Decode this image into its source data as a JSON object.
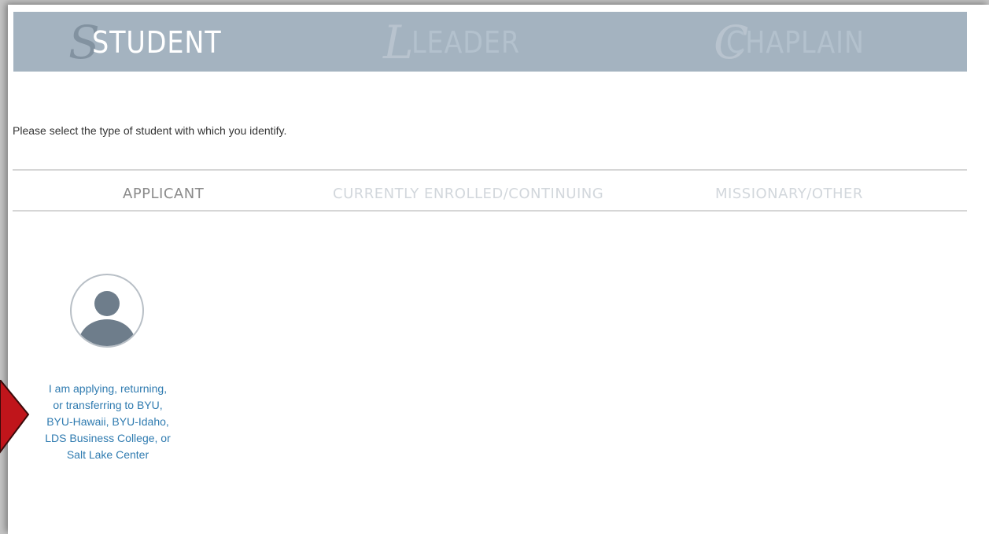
{
  "roles": [
    {
      "initial": "S",
      "label": "STUDENT",
      "active": true
    },
    {
      "initial": "L",
      "label": "LEADER",
      "active": false
    },
    {
      "initial": "C",
      "label": "CHAPLAIN",
      "active": false
    }
  ],
  "prompt": "Please select the type of student with which you identify.",
  "student_types": [
    {
      "label": "APPLICANT",
      "active": true
    },
    {
      "label": "CURRENTLY ENROLLED/CONTINUING",
      "active": false
    },
    {
      "label": "MISSIONARY/OTHER",
      "active": false
    }
  ],
  "applicant_card": {
    "icon": "user-avatar-icon",
    "text": "I am applying, returning,\nor transferring to BYU,\nBYU-Hawaii, BYU-Idaho,\nLDS Business College, or\nSalt Lake Center"
  },
  "colors": {
    "role_bar": "#a4b3c0",
    "active_role": "#ffffff",
    "link": "#2f7bb0",
    "pointer": "#c0151b"
  }
}
